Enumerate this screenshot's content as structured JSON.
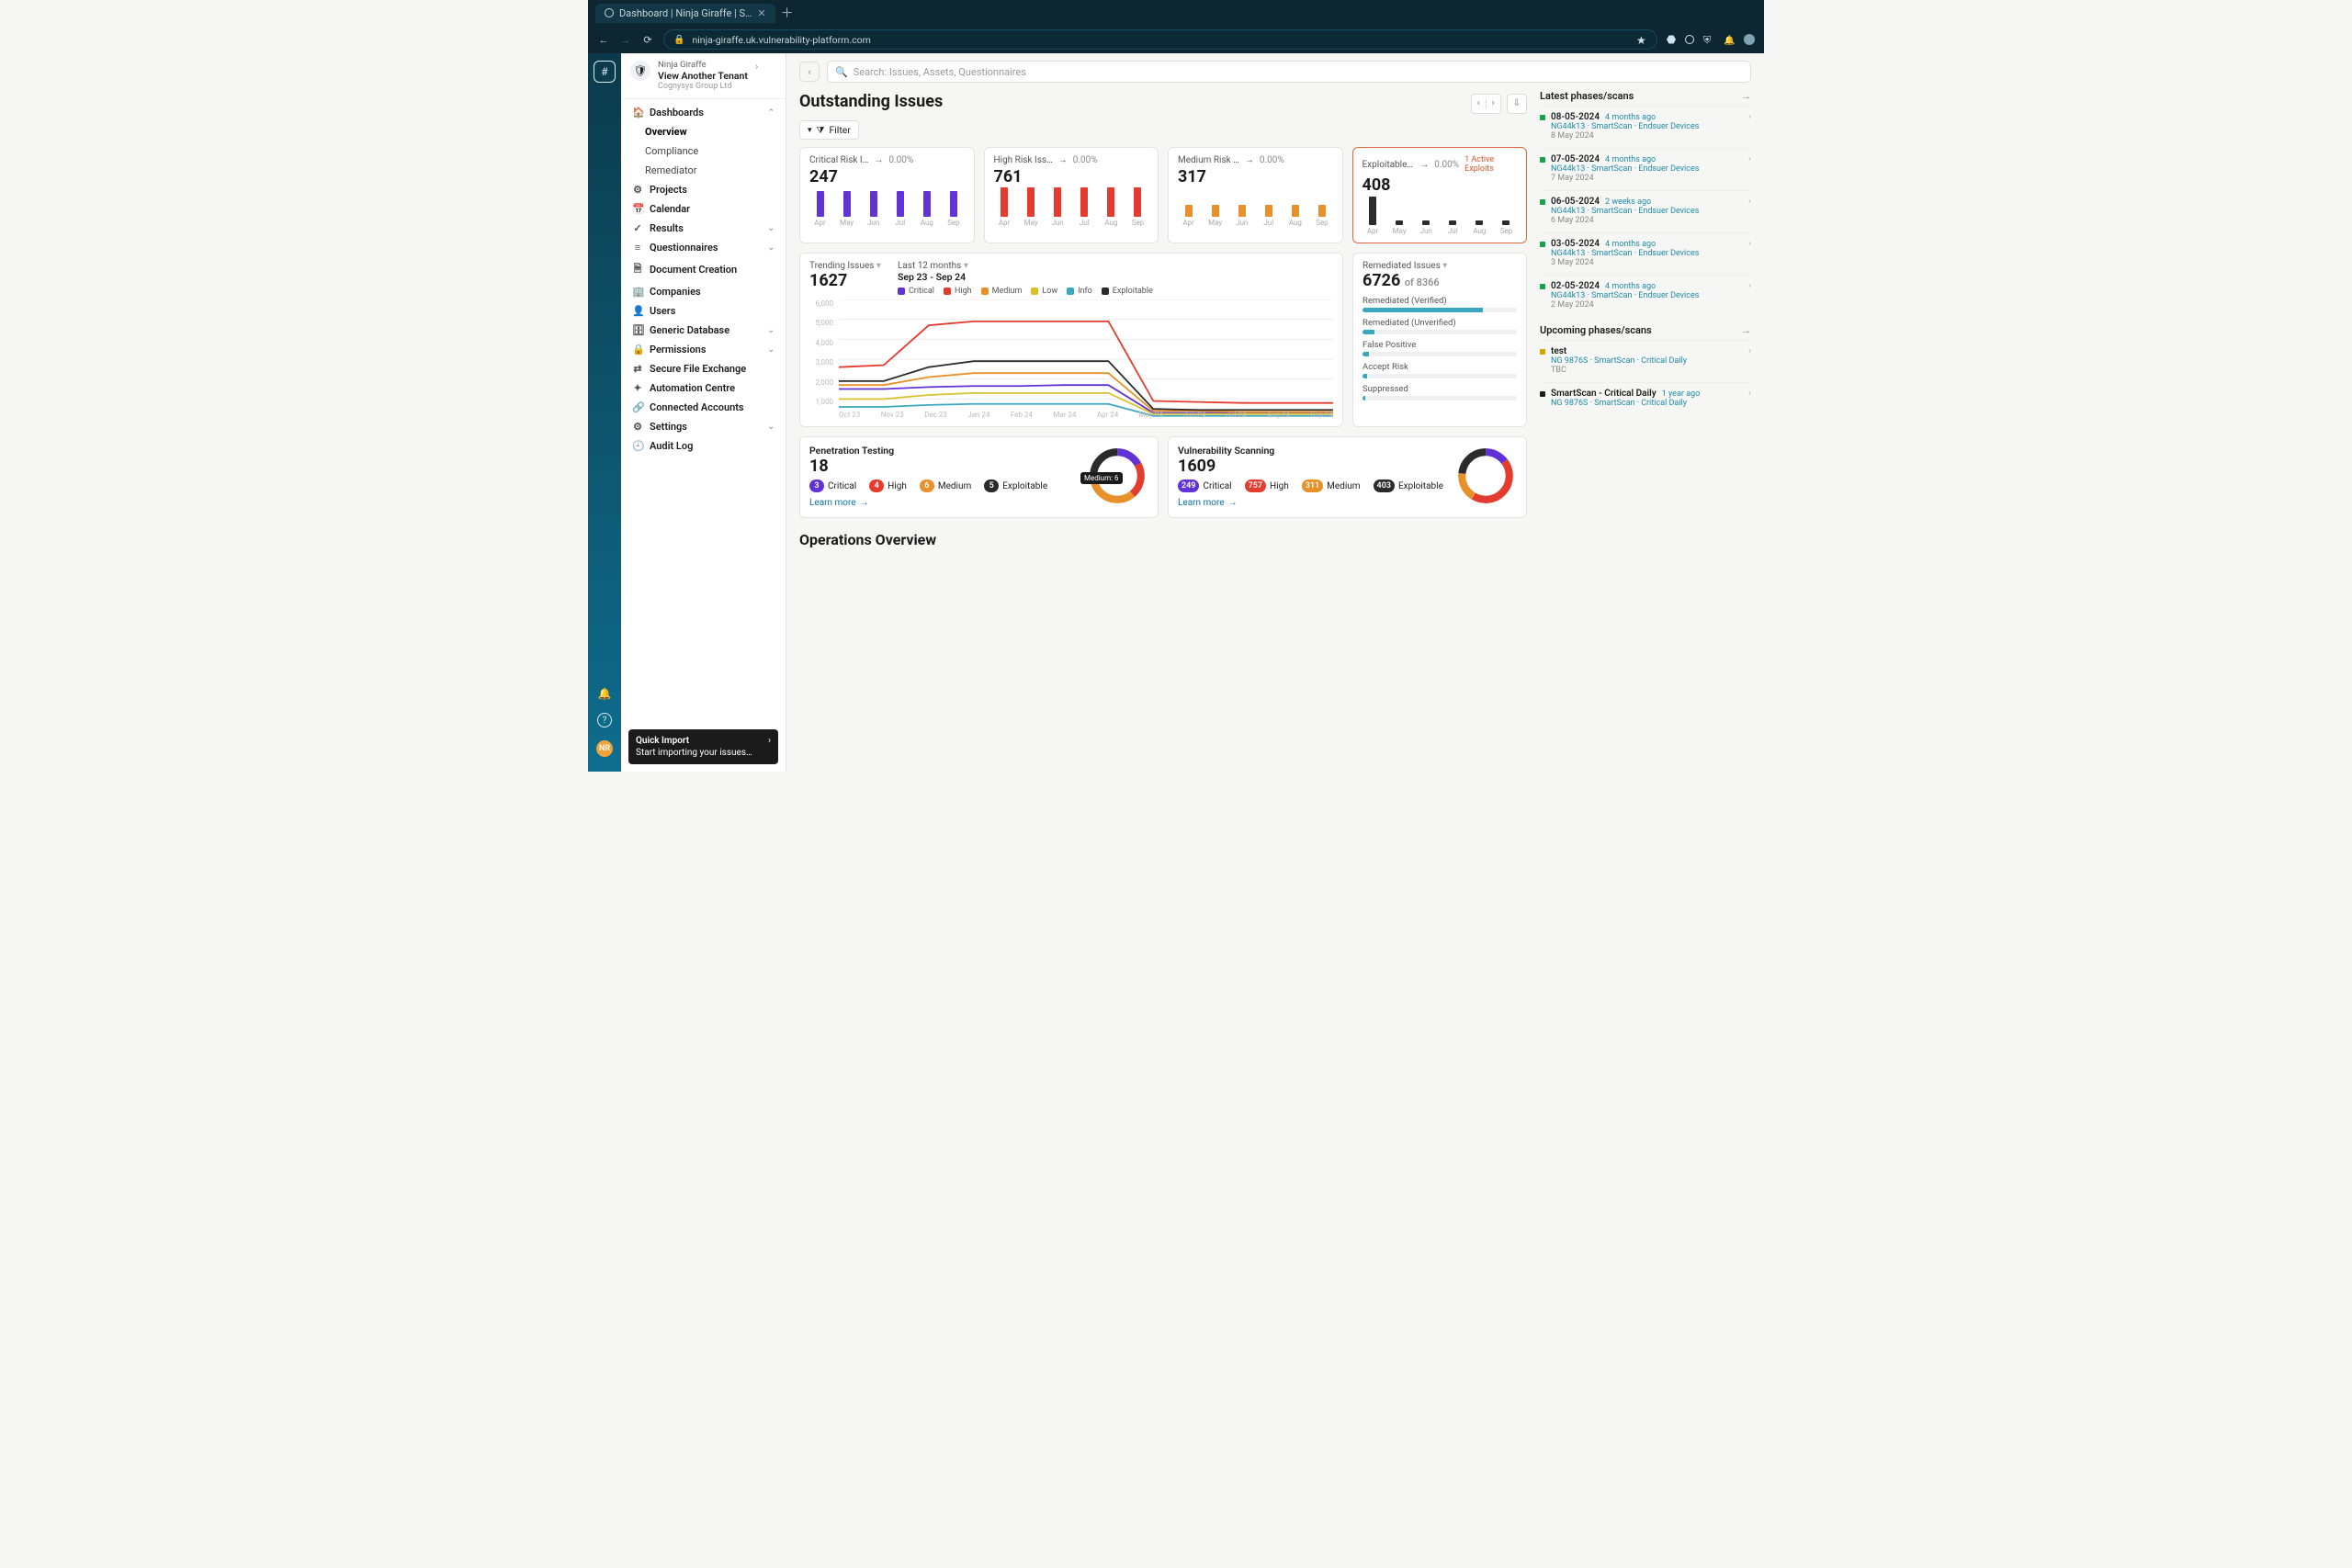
{
  "browser": {
    "tab_title": "Dashboard | Ninja Giraffe | S…",
    "url": "ninja-giraffe.uk.vulnerability-platform.com"
  },
  "tenant": {
    "line1": "Ninja Giraffe",
    "line2": "View Another Tenant",
    "line3": "Cognysys Group Ltd"
  },
  "sidebar": {
    "items": [
      {
        "icon": "🏠",
        "label": "Dashboards",
        "expandable": true,
        "expanded": true,
        "children": [
          {
            "label": "Overview",
            "active": true
          },
          {
            "label": "Compliance"
          },
          {
            "label": "Remediator"
          }
        ]
      },
      {
        "icon": "⚙",
        "label": "Projects"
      },
      {
        "icon": "📅",
        "label": "Calendar"
      },
      {
        "icon": "✓",
        "label": "Results",
        "expandable": true
      },
      {
        "icon": "≡",
        "label": "Questionnaires",
        "expandable": true
      },
      {
        "icon": "🗎",
        "label": "Document Creation"
      },
      {
        "icon": "🏢",
        "label": "Companies"
      },
      {
        "icon": "👤",
        "label": "Users"
      },
      {
        "icon": "🗄",
        "label": "Generic Database",
        "expandable": true
      },
      {
        "icon": "🔒",
        "label": "Permissions",
        "expandable": true
      },
      {
        "icon": "⇄",
        "label": "Secure File Exchange"
      },
      {
        "icon": "✦",
        "label": "Automation Centre"
      },
      {
        "icon": "🔗",
        "label": "Connected Accounts"
      },
      {
        "icon": "⚙",
        "label": "Settings",
        "expandable": true
      },
      {
        "icon": "🕘",
        "label": "Audit Log"
      }
    ]
  },
  "quick_import": {
    "title": "Quick Import",
    "sub": "Start importing your issues…"
  },
  "search_placeholder": "Search: Issues, Assets, Questionnaires",
  "page_title": "Outstanding Issues",
  "filter_label": "Filter",
  "risk_cards": [
    {
      "title": "Critical Risk I…",
      "delta": "0.00%",
      "value": 247,
      "color": "#6132d6",
      "alert": false
    },
    {
      "title": "High Risk Iss…",
      "delta": "0.00%",
      "value": 761,
      "color": "#e33b2e",
      "alert": false
    },
    {
      "title": "Medium Risk …",
      "delta": "0.00%",
      "value": 317,
      "color": "#e8912a",
      "alert": false
    },
    {
      "title": "Exploitable Is…",
      "delta": "0.00%",
      "value": 408,
      "color": "#2b2b2b",
      "alert": true,
      "flag": "1 Active Exploits"
    }
  ],
  "risk_months": [
    "Apr",
    "May",
    "Jun",
    "Jul",
    "Aug",
    "Sep"
  ],
  "trending": {
    "title": "Trending Issues",
    "value": 1627,
    "range_label": "Last 12 months",
    "range": "Sep 23 - Sep 24",
    "legend": [
      {
        "name": "Critical",
        "color": "#6132d6"
      },
      {
        "name": "High",
        "color": "#e33b2e"
      },
      {
        "name": "Medium",
        "color": "#e8912a"
      },
      {
        "name": "Low",
        "color": "#d7c22d"
      },
      {
        "name": "Info",
        "color": "#3aa7c1"
      },
      {
        "name": "Exploitable",
        "color": "#2b2b2b"
      }
    ],
    "x": [
      "Oct 23",
      "Nov 23",
      "Dec 23",
      "Jan 24",
      "Feb 24",
      "Mar 24",
      "Apr 24",
      "May 24",
      "Jun 24",
      "Jul 24",
      "Aug 24",
      "Sep 24"
    ]
  },
  "remediated": {
    "title": "Remediated Issues",
    "value": 6726,
    "of_label": "of",
    "total": 8366,
    "rows": [
      {
        "label": "Remediated (Verified)",
        "pct": 78
      },
      {
        "label": "Remediated (Unverified)",
        "pct": 8
      },
      {
        "label": "False Positive",
        "pct": 4
      },
      {
        "label": "Accept Risk",
        "pct": 3
      },
      {
        "label": "Suppressed",
        "pct": 2
      }
    ]
  },
  "pen_test": {
    "title": "Penetration Testing",
    "value": 18,
    "sev": [
      {
        "n": 3,
        "label": "Critical",
        "color": "#6132d6"
      },
      {
        "n": 4,
        "label": "High",
        "color": "#e33b2e"
      },
      {
        "n": 6,
        "label": "Medium",
        "color": "#e8912a"
      },
      {
        "n": 5,
        "label": "Exploitable",
        "color": "#2b2b2b"
      }
    ],
    "donut_tip": "Medium: 6",
    "learn": "Learn more"
  },
  "vuln_scan": {
    "title": "Vulnerability Scanning",
    "value": 1609,
    "sev": [
      {
        "n": 249,
        "label": "Critical",
        "color": "#6132d6"
      },
      {
        "n": 757,
        "label": "High",
        "color": "#e33b2e"
      },
      {
        "n": 311,
        "label": "Medium",
        "color": "#e8912a"
      },
      {
        "n": 403,
        "label": "Exploitable",
        "color": "#2b2b2b"
      }
    ],
    "learn": "Learn more"
  },
  "operations_title": "Operations Overview",
  "latest_title": "Latest phases/scans",
  "latest": [
    {
      "date": "08-05-2024",
      "ago": "4 months ago",
      "detail": "NG44k13 · SmartScan · Endsuer Devices",
      "sub": "8 May 2024"
    },
    {
      "date": "07-05-2024",
      "ago": "4 months ago",
      "detail": "NG44k13 · SmartScan · Endsuer Devices",
      "sub": "7 May 2024"
    },
    {
      "date": "06-05-2024",
      "ago": "2 weeks ago",
      "detail": "NG44k13 · SmartScan · Endsuer Devices",
      "sub": "6 May 2024"
    },
    {
      "date": "03-05-2024",
      "ago": "4 months ago",
      "detail": "NG44k13 · SmartScan · Endsuer Devices",
      "sub": "3 May 2024"
    },
    {
      "date": "02-05-2024",
      "ago": "4 months ago",
      "detail": "NG44k13 · SmartScan · Endsuer Devices",
      "sub": "2 May 2024"
    }
  ],
  "upcoming_title": "Upcoming phases/scans",
  "upcoming": [
    {
      "dot": "amber",
      "date": "test",
      "ago": "",
      "detail": "NG 9876S · SmartScan · Critical Daily",
      "sub": "TBC"
    },
    {
      "dot": "blk",
      "date": "SmartScan - Critical Daily",
      "ago": "1 year ago",
      "detail": "NG 9876S · SmartScan · Critical Daily",
      "sub": ""
    }
  ],
  "chart_data": [
    {
      "type": "bar",
      "title": "Critical Risk Issues",
      "categories": [
        "Apr",
        "May",
        "Jun",
        "Jul",
        "Aug",
        "Sep"
      ],
      "values": [
        247,
        247,
        247,
        247,
        247,
        247
      ],
      "ylim": [
        0,
        300
      ]
    },
    {
      "type": "bar",
      "title": "High Risk Issues",
      "categories": [
        "Apr",
        "May",
        "Jun",
        "Jul",
        "Aug",
        "Sep"
      ],
      "values": [
        761,
        761,
        761,
        761,
        761,
        761
      ],
      "ylim": [
        0,
        800
      ]
    },
    {
      "type": "bar",
      "title": "Medium Risk Issues",
      "categories": [
        "Apr",
        "May",
        "Jun",
        "Jul",
        "Aug",
        "Sep"
      ],
      "values": [
        317,
        317,
        317,
        317,
        317,
        317
      ],
      "ylim": [
        0,
        800
      ]
    },
    {
      "type": "bar",
      "title": "Exploitable Issues",
      "categories": [
        "Apr",
        "May",
        "Jun",
        "Jul",
        "Aug",
        "Sep"
      ],
      "values": [
        408,
        60,
        60,
        60,
        60,
        60
      ],
      "ylim": [
        0,
        450
      ]
    },
    {
      "type": "line",
      "title": "Trending Issues",
      "xlabel": "",
      "ylabel": "",
      "x": [
        "Oct 23",
        "Nov 23",
        "Dec 23",
        "Jan 24",
        "Feb 24",
        "Mar 24",
        "Apr 24",
        "May 24",
        "Jun 24",
        "Jul 24",
        "Aug 24",
        "Sep 24"
      ],
      "yticks": [
        1000,
        2000,
        3000,
        4000,
        5000,
        6000
      ],
      "ylim": [
        0,
        6000
      ],
      "series": [
        {
          "name": "Critical",
          "color": "#6132d6",
          "values": [
            1500,
            1500,
            1600,
            1650,
            1650,
            1700,
            1700,
            300,
            300,
            300,
            300,
            300
          ]
        },
        {
          "name": "High",
          "color": "#e33b2e",
          "values": [
            2600,
            2700,
            4700,
            4900,
            4900,
            4900,
            4900,
            900,
            850,
            800,
            800,
            800
          ]
        },
        {
          "name": "Medium",
          "color": "#e8912a",
          "values": [
            1700,
            1700,
            2100,
            2300,
            2300,
            2300,
            2300,
            400,
            400,
            350,
            350,
            350
          ]
        },
        {
          "name": "Low",
          "color": "#d7c22d",
          "values": [
            1000,
            1000,
            1200,
            1300,
            1300,
            1300,
            1300,
            250,
            250,
            250,
            250,
            250
          ]
        },
        {
          "name": "Info",
          "color": "#3aa7c1",
          "values": [
            600,
            600,
            700,
            750,
            750,
            750,
            750,
            150,
            150,
            150,
            150,
            150
          ]
        },
        {
          "name": "Exploitable",
          "color": "#2b2b2b",
          "values": [
            1900,
            1900,
            2600,
            2900,
            2900,
            2900,
            2900,
            500,
            450,
            450,
            450,
            450
          ]
        }
      ]
    },
    {
      "type": "pie",
      "title": "Penetration Testing",
      "series": [
        {
          "name": "Critical",
          "value": 3,
          "color": "#6132d6"
        },
        {
          "name": "High",
          "value": 4,
          "color": "#e33b2e"
        },
        {
          "name": "Medium",
          "value": 6,
          "color": "#e8912a"
        },
        {
          "name": "Exploitable",
          "value": 5,
          "color": "#2b2b2b"
        }
      ]
    },
    {
      "type": "pie",
      "title": "Vulnerability Scanning",
      "series": [
        {
          "name": "Critical",
          "value": 249,
          "color": "#6132d6"
        },
        {
          "name": "High",
          "value": 757,
          "color": "#e33b2e"
        },
        {
          "name": "Medium",
          "value": 311,
          "color": "#e8912a"
        },
        {
          "name": "Exploitable",
          "value": 403,
          "color": "#2b2b2b"
        }
      ]
    }
  ]
}
